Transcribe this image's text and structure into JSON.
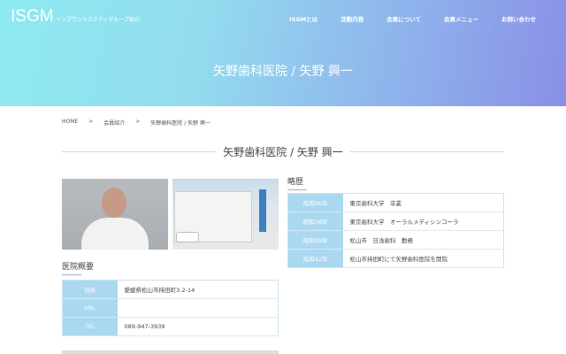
{
  "header": {
    "logo": "ISGM",
    "logo_sub": "インプラントスタディグループ松山",
    "nav": [
      "ISGMとは",
      "活動内容",
      "会員について",
      "会員メニュー",
      "お問い合わせ"
    ],
    "hero_title": "矢野歯科医院 / 矢野 興一"
  },
  "breadcrumb": [
    "HOME",
    ">",
    "会員紹介",
    ">",
    "矢野歯科医院 / 矢野 興一"
  ],
  "page_title": "矢野歯科医院 / 矢野 興一",
  "history": {
    "title": "略歴",
    "rows": [
      {
        "k": "昭和36年",
        "v": "東京歯科大学　卒業"
      },
      {
        "k": "昭和38年",
        "v": "東京歯科大学　オーラルメディシンコーラ"
      },
      {
        "k": "昭和39年",
        "v": "松山市　日浅歯科　勤務"
      },
      {
        "k": "昭和42年",
        "v": "松山市持田町にて矢野歯科医院を開院"
      }
    ]
  },
  "clinic": {
    "title": "医院概要",
    "rows": [
      {
        "k": "住所",
        "v": "愛媛県松山市持田町3-2-14"
      },
      {
        "k": "URL",
        "v": ""
      },
      {
        "k": "TEL",
        "v": "089-947-3939"
      }
    ]
  }
}
